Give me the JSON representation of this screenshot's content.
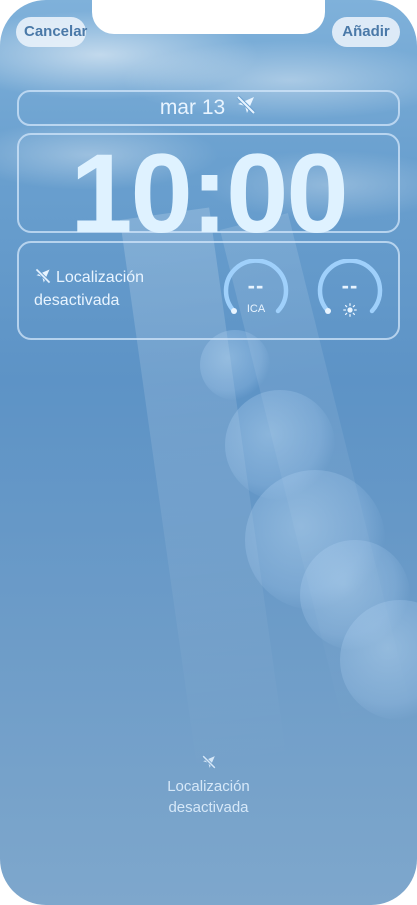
{
  "header": {
    "cancel_label": "Cancelar",
    "add_label": "Añadir"
  },
  "lockscreen": {
    "date": "mar 13",
    "time": "10:00"
  },
  "widgets": {
    "location_status": "Localización desactivada",
    "aqi": {
      "value": "--",
      "label": "ICA"
    },
    "uv": {
      "value": "--",
      "icon": "sun-icon"
    }
  },
  "bottom": {
    "location_line1": "Localización",
    "location_line2": "desactivada"
  },
  "colors": {
    "accent_text": "#4a79a8",
    "widget_text": "#e8f4ff",
    "gauge_stroke": "#9fd0fb"
  }
}
